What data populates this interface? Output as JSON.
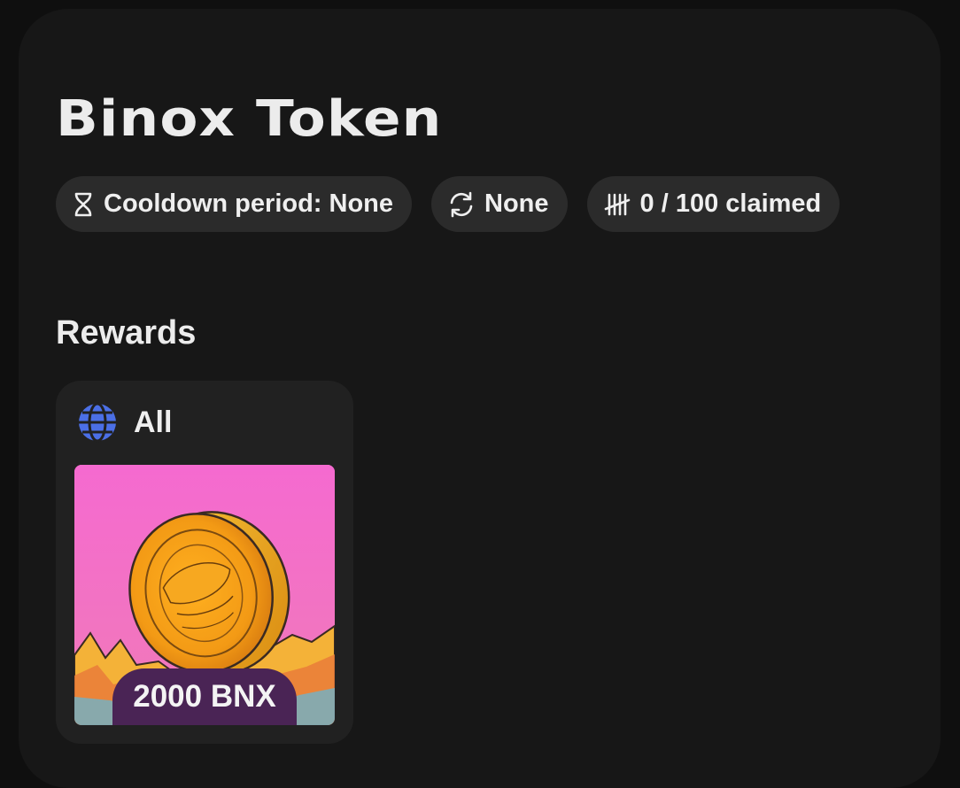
{
  "header": {
    "title": "Binox Token"
  },
  "chips": [
    {
      "icon": "hourglass-icon",
      "label": "Cooldown period: None"
    },
    {
      "icon": "refresh-icon",
      "label": "None"
    },
    {
      "icon": "tally-marks-icon",
      "label": "0 / 100 claimed"
    }
  ],
  "rewards": {
    "section_title": "Rewards",
    "cards": [
      {
        "region_icon": "globe-icon",
        "region_label": "All",
        "image": "gold-coin-illustration",
        "amount": "2000 BNX"
      }
    ]
  },
  "colors": {
    "background": "#0f0f0f",
    "panel": "#171717",
    "chip": "#2b2b2b",
    "card": "#212121",
    "globe_icon": "#4b6fe6",
    "image_background": "#f06bc6",
    "amount_pill": "#4a2455"
  }
}
